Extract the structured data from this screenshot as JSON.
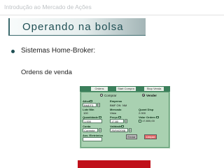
{
  "header": {
    "title": "Introdução ao Mercado de Ações"
  },
  "slide": {
    "title": "Operando na bolsa",
    "bullet": "Sistemas Home-Broker:",
    "subtitle": "Ordens de venda"
  },
  "widget": {
    "tabs": [
      "Ordens",
      "Start Compra",
      "Stop Venda"
    ],
    "buy_label": "Comprar",
    "sell_label": "Vender",
    "selected_side": "Vender",
    "fields": {
      "ativo_label": "Ativo",
      "ativo_value": "BMEF3",
      "empresa_label": "Empresa",
      "empresa_value": "BMF ON",
      "empresa_type": "NM",
      "lote_label": "Lote Mín",
      "lote_value": "100",
      "mercado_label": "Mercado",
      "mercado_value": "Vista",
      "quant_disp_label": "Quant Disp",
      "quant_disp_value": "2.000",
      "quantidade_label": "Quantidade",
      "quantidade_value": "1.000",
      "preco_label": "Preço",
      "preco_value": "17,80",
      "valor_label": "Valor Ordem",
      "valor_value": "17.800,00",
      "conta_label": "Conta",
      "conta_value": "Corrente",
      "validade_label": "Validade",
      "validade_value": "25/04/2008",
      "ass_label": "Ass. Eletrônica"
    },
    "buttons": {
      "send": "Enviar",
      "clear": "Limpar"
    }
  },
  "colors": {
    "title": "#1f4f54",
    "widget_bg": "#a9d1b1",
    "tab_bar": "#3b7f5b",
    "accent_red": "#c0101a"
  }
}
